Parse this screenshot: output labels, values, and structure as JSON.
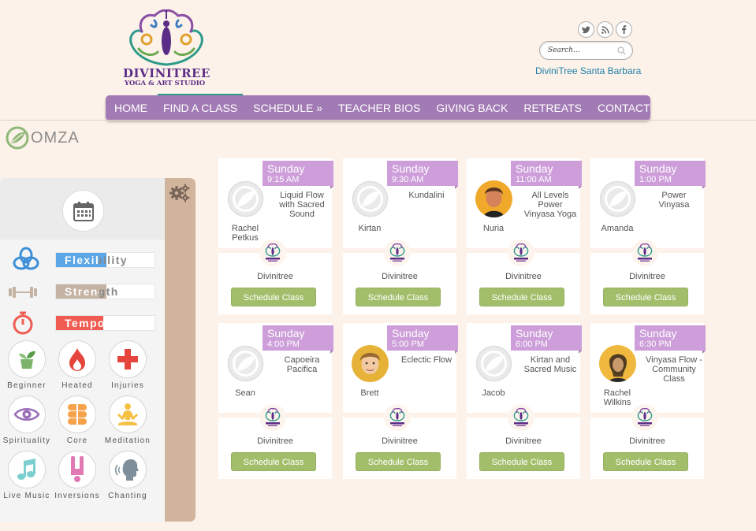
{
  "brand": {
    "name": "DIVINITREE",
    "subtitle": "YOGA & ART STUDIO",
    "location_link": "DiviniTree Santa Barbara",
    "colors": {
      "purple": "#a27bb5",
      "lavender": "#cd9ed9",
      "green": "#a3be6b",
      "teal": "#2a9a8c"
    }
  },
  "social": [
    {
      "icon": "twitter-icon"
    },
    {
      "icon": "rss-icon"
    },
    {
      "icon": "facebook-icon"
    }
  ],
  "search": {
    "placeholder": "Search...",
    "value": ""
  },
  "nav": {
    "items": [
      {
        "label": "HOME"
      },
      {
        "label": "FIND A CLASS"
      },
      {
        "label": "SCHEDULE »"
      },
      {
        "label": "TEACHER BIOS"
      },
      {
        "label": "GIVING BACK"
      },
      {
        "label": "RETREATS"
      },
      {
        "label": "CONTACT"
      }
    ],
    "active_index": 1
  },
  "omza": {
    "label": "OMZA"
  },
  "sidebar": {
    "metrics": [
      {
        "label": "Flexibility",
        "icon": "knot-icon",
        "color": "#5aa6e6",
        "level": 0.51
      },
      {
        "label": "Strength",
        "icon": "dumbbell-icon",
        "color": "#c4b2a3",
        "level": 0.51
      },
      {
        "label": "Tempo",
        "icon": "stopwatch-icon",
        "color": "#f05c52",
        "level": 0.48
      }
    ],
    "tags": [
      {
        "label": "Beginner",
        "icon": "sprout-icon"
      },
      {
        "label": "Heated",
        "icon": "flame-icon"
      },
      {
        "label": "Injuries",
        "icon": "medical-cross-icon"
      },
      {
        "label": "Spirituality",
        "icon": "eye-icon"
      },
      {
        "label": "Core",
        "icon": "core-icon"
      },
      {
        "label": "Meditation",
        "icon": "meditation-icon"
      },
      {
        "label": "Live Music",
        "icon": "music-note-icon"
      },
      {
        "label": "Inversions",
        "icon": "inversion-icon"
      },
      {
        "label": "Chanting",
        "icon": "chanting-icon"
      }
    ]
  },
  "classes": [
    {
      "day": "Sunday",
      "time": "9:15 AM",
      "name": "Liquid Flow with Sacred Sound",
      "teacher": "Rachel Petkus",
      "avatar": "placeholder",
      "studio": "Divinitree",
      "button": "Schedule Class"
    },
    {
      "day": "Sunday",
      "time": "9:30 AM",
      "name": "Kundalini",
      "teacher": "Kirtan",
      "avatar": "placeholder",
      "studio": "Divinitree",
      "button": "Schedule Class"
    },
    {
      "day": "Sunday",
      "time": "11:00 AM",
      "name": "All Levels Power Vinyasa Yoga",
      "teacher": "Nuria",
      "avatar": "photo-woman",
      "studio": "Divinitree",
      "button": "Schedule Class"
    },
    {
      "day": "Sunday",
      "time": "1:00 PM",
      "name": "Power Vinyasa",
      "teacher": "Amanda",
      "avatar": "placeholder",
      "studio": "Divinitree",
      "button": "Schedule Class"
    },
    {
      "day": "Sunday",
      "time": "4:00 PM",
      "name": "Capoeira Pacifica",
      "teacher": "Sean",
      "avatar": "placeholder",
      "studio": "Divinitree",
      "button": "Schedule Class"
    },
    {
      "day": "Sunday",
      "time": "5:00 PM",
      "name": "Eclectic Flow",
      "teacher": "Brett",
      "avatar": "photo-man",
      "studio": "Divinitree",
      "button": "Schedule Class"
    },
    {
      "day": "Sunday",
      "time": "6:00 PM",
      "name": "Kirtan and Sacred Music",
      "teacher": "Jacob",
      "avatar": "placeholder",
      "studio": "Divinitree",
      "button": "Schedule Class"
    },
    {
      "day": "Sunday",
      "time": "6:30 PM",
      "name": "Vinyasa Flow - Community Class",
      "teacher": "Rachel Wilkins",
      "avatar": "photo-woman2",
      "studio": "Divinitree",
      "button": "Schedule Class"
    }
  ]
}
